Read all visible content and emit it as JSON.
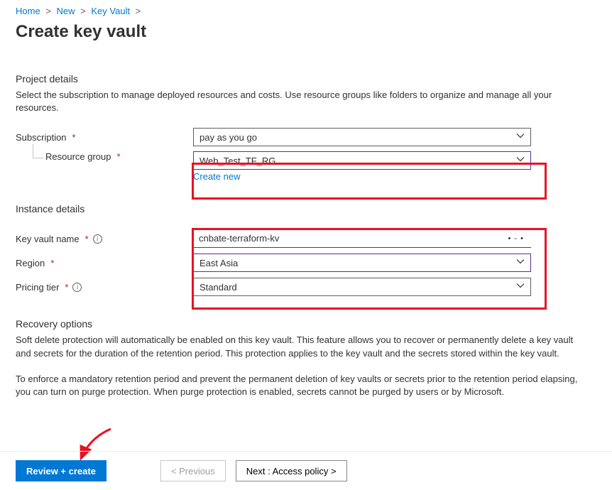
{
  "breadcrumb": {
    "items": [
      "Home",
      "New",
      "Key Vault"
    ]
  },
  "page": {
    "title": "Create key vault"
  },
  "project": {
    "heading": "Project details",
    "desc": "Select the subscription to manage deployed resources and costs. Use resource groups like folders to organize and manage all your resources."
  },
  "subscription": {
    "label": "Subscription",
    "value": "pay as you go"
  },
  "resourceGroup": {
    "label": "Resource group",
    "value": "Web_Test_TF_RG",
    "createNew": "Create new"
  },
  "instance": {
    "heading": "Instance details"
  },
  "kvName": {
    "label": "Key vault name",
    "value": "cnbate-terraform-kv"
  },
  "region": {
    "label": "Region",
    "value": "East Asia"
  },
  "pricing": {
    "label": "Pricing tier",
    "value": "Standard"
  },
  "recovery": {
    "heading": "Recovery options",
    "p1": "Soft delete protection will automatically be enabled on this key vault. This feature allows you to recover or permanently delete a key vault and secrets for the duration of the retention period. This protection applies to the key vault and the secrets stored within the key vault.",
    "p2": "To enforce a mandatory retention period and prevent the permanent deletion of key vaults or secrets prior to the retention period elapsing, you can turn on purge protection. When purge protection is enabled, secrets cannot be purged by users or by Microsoft."
  },
  "footer": {
    "review": "Review + create",
    "previous": "< Previous",
    "next": "Next : Access policy >"
  }
}
